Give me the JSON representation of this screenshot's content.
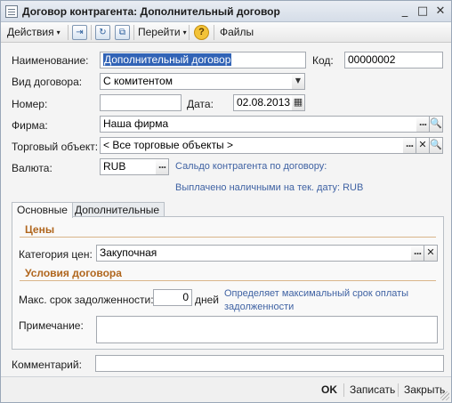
{
  "window": {
    "title": "Договор контрагента: Дополнительный договор",
    "minimize_glyph": "_",
    "maximize_glyph": "□",
    "close_glyph": "✕"
  },
  "toolbar": {
    "actions_label": "Действия",
    "goto_label": "Перейти",
    "files_label": "Файлы",
    "help_glyph": "?",
    "caret": "▾"
  },
  "form": {
    "name_label": "Наименование:",
    "name_value": "Дополнительный договор",
    "code_label": "Код:",
    "code_value": "00000002",
    "contract_type_label": "Вид договора:",
    "contract_type_value": "С комитентом",
    "number_label": "Номер:",
    "number_value": "",
    "date_label": "Дата:",
    "date_value": "02.08.2013",
    "company_label": "Фирма:",
    "company_value": "Наша фирма",
    "trade_object_label": "Торговый объект:",
    "trade_object_value": "< Все торговые объекты >",
    "currency_label": "Валюта:",
    "currency_value": "RUB",
    "balance_link": "Сальдо контрагента по договору:",
    "paid_cash_link": "Выплачено наличными на тек. дату:  RUB",
    "dots_glyph": "...",
    "search_glyph": "🔍",
    "clear_glyph": "✕",
    "dropdown_glyph": "▼",
    "calendar_glyph": "▦"
  },
  "tabs": [
    {
      "label": "Основные"
    },
    {
      "label": "Дополнительные"
    }
  ],
  "main_tab": {
    "prices_group": "Цены",
    "price_category_label": "Категория цен:",
    "price_category_value": "Закупочная",
    "terms_group": "Условия договора",
    "max_debt_label": "Макс. срок задолженности:",
    "max_debt_value": "0",
    "max_debt_unit": "дней",
    "max_debt_hint_line1": "Определяет максимальный срок оплаты",
    "max_debt_hint_line2": "задолженности",
    "note_label": "Примечание:",
    "note_value": ""
  },
  "comment": {
    "label": "Комментарий:",
    "value": ""
  },
  "footer": {
    "ok_label": "OK",
    "save_label": "Записать",
    "close_label": "Закрыть"
  }
}
